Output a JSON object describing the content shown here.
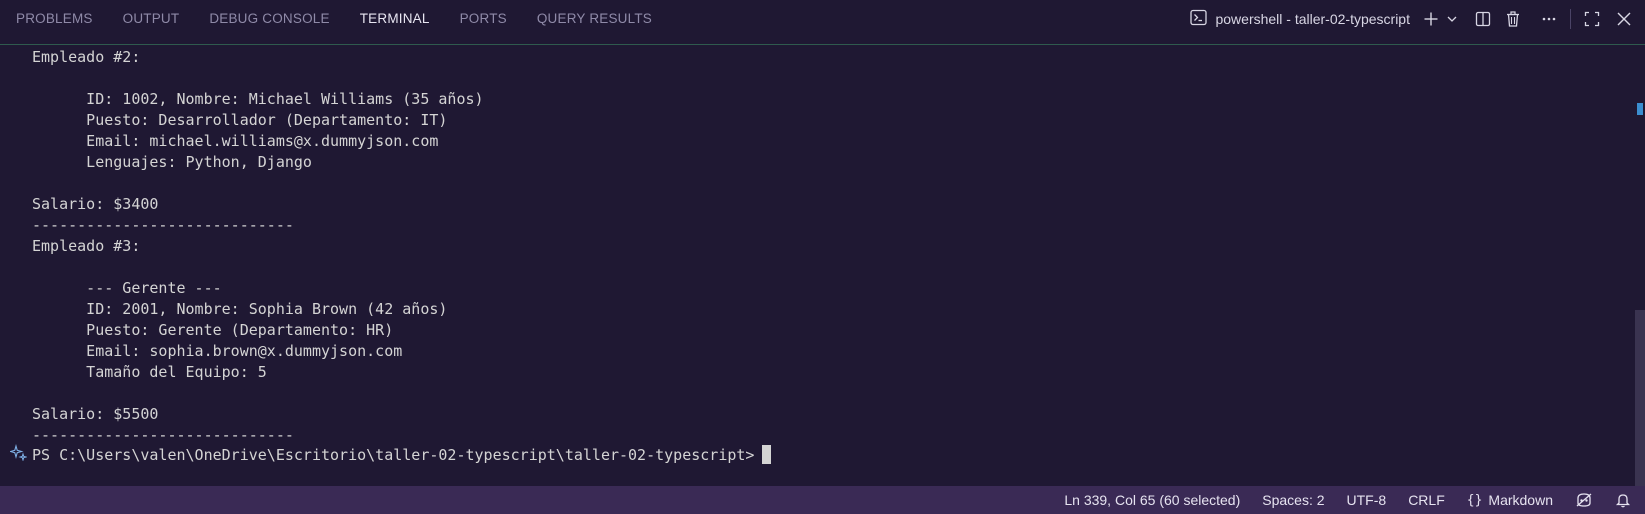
{
  "panel": {
    "tabs": [
      {
        "label": "PROBLEMS"
      },
      {
        "label": "OUTPUT"
      },
      {
        "label": "DEBUG CONSOLE"
      },
      {
        "label": "TERMINAL",
        "active": true
      },
      {
        "label": "PORTS"
      },
      {
        "label": "QUERY RESULTS"
      }
    ],
    "terminal_selector": {
      "icon": "terminal-icon",
      "label": "powershell - taller-02-typescript"
    },
    "actions": [
      "plus-icon",
      "chevron-down-icon",
      "split-icon",
      "trash-icon",
      "more-icon",
      "maximize-icon",
      "close-icon"
    ]
  },
  "terminal": {
    "lines": [
      "Empleado #2:",
      "",
      "      ID: 1002, Nombre: Michael Williams (35 años)",
      "      Puesto: Desarrollador (Departamento: IT)",
      "      Email: michael.williams@x.dummyjson.com",
      "      Lenguajes: Python, Django",
      "",
      "Salario: $3400",
      "-----------------------------",
      "Empleado #3:",
      "",
      "      --- Gerente ---",
      "      ID: 2001, Nombre: Sophia Brown (42 años)",
      "      Puesto: Gerente (Departamento: HR)",
      "      Email: sophia.brown@x.dummyjson.com",
      "      Tamaño del Equipo: 5",
      "",
      "Salario: $5500",
      "-----------------------------"
    ],
    "prompt": "PS C:\\Users\\valen\\OneDrive\\Escritorio\\taller-02-typescript\\taller-02-typescript>"
  },
  "statusbar": {
    "position": "Ln 339, Col 65 (60 selected)",
    "spaces": "Spaces: 2",
    "encoding": "UTF-8",
    "eol": "CRLF",
    "language": "Markdown",
    "language_icon": "braces-icon",
    "copilot_icon": "copilot-icon",
    "bell_icon": "bell-icon"
  },
  "colors": {
    "background": "#1f1833",
    "statusbar": "#3a2a55",
    "accent_border": "#2f5a4e"
  }
}
